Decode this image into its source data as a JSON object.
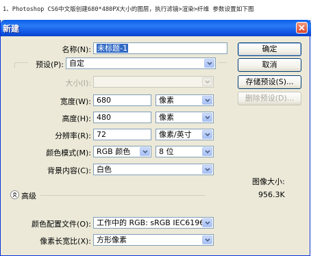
{
  "caption": "1、Photoshop CS6中文版创建680*480PX大小的图层，执行滤镜>渲染>纤维 参数设置如下图",
  "window": {
    "title": "新建"
  },
  "form": {
    "name_label": "名称(N):",
    "name_value": "未标题-1",
    "preset_label": "预设(P):",
    "preset_value": "自定",
    "size_label": "大小(I):",
    "size_value": "",
    "width_label": "宽度(W):",
    "width_value": "680",
    "width_unit": "像素",
    "height_label": "高度(H):",
    "height_value": "480",
    "height_unit": "像素",
    "resolution_label": "分辨率(R):",
    "resolution_value": "72",
    "resolution_unit": "像素/英寸",
    "colormode_label": "颜色模式(M):",
    "colormode_value": "RGB 颜色",
    "colormode_bits": "8 位",
    "background_label": "背景内容(C):",
    "background_value": "白色",
    "advanced_label": "高级",
    "profile_label": "颜色配置文件(O):",
    "profile_value": "工作中的 RGB: sRGB IEC6196...",
    "aspect_label": "像素长宽比(X):",
    "aspect_value": "方形像素"
  },
  "buttons": {
    "ok": "确定",
    "cancel": "取消",
    "save_preset": "存储预设(S)...",
    "delete_preset": "删除预设(D)..."
  },
  "info": {
    "image_size_label": "图像大小:",
    "image_size_value": "956.3K"
  },
  "colors": {
    "titlebar": "#0a5ee8",
    "dialog_bg": "#ece9d8",
    "field_border": "#7f9db9",
    "button_border": "#003c74"
  }
}
